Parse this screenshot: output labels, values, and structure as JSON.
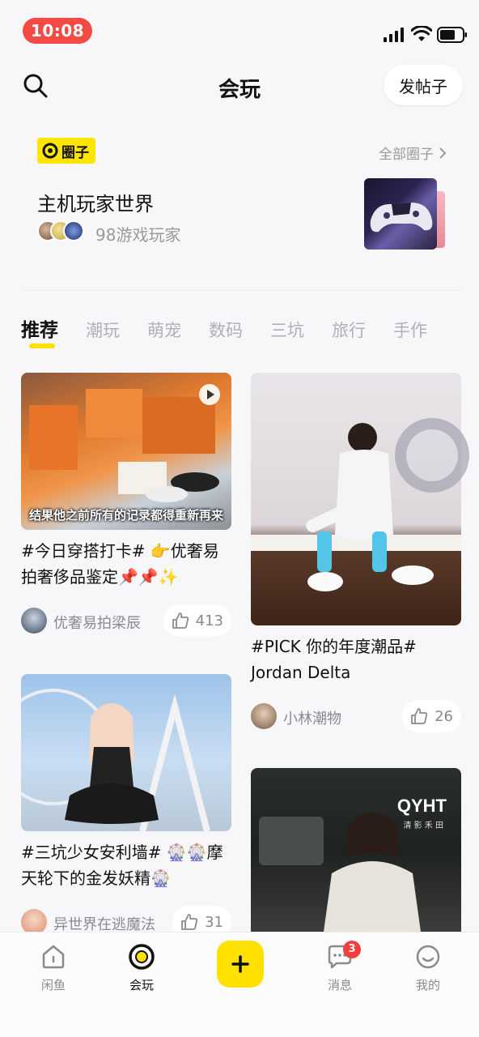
{
  "status_bar": {
    "time": "10:08"
  },
  "header": {
    "title": "会玩",
    "post_button": "发帖子"
  },
  "circle": {
    "badge": "圈子",
    "all_link": "全部圈子",
    "name": "主机玩家世界",
    "member_count": "98游戏玩家"
  },
  "tabs": [
    {
      "label": "推荐",
      "active": true
    },
    {
      "label": "潮玩"
    },
    {
      "label": "萌宠"
    },
    {
      "label": "数码"
    },
    {
      "label": "三坑"
    },
    {
      "label": "旅行"
    },
    {
      "label": "手作"
    }
  ],
  "feed": {
    "card1": {
      "caption": "结果他之前所有的记录都得重新再来",
      "title": "#今日穿搭打卡# 👉优奢易拍奢侈品鉴定📌📌✨",
      "author": "优奢易拍梁辰",
      "likes": "413"
    },
    "card2": {
      "title": "#PICK 你的年度潮品# Jordan Delta",
      "author": "小林潮物",
      "likes": "26"
    },
    "card3": {
      "title": "#三坑少女安利墙# 🎡🎡摩天轮下的金发妖精🎡",
      "author": "异世界在逃魔法",
      "likes": "31"
    },
    "card4": {
      "logo_text": "QYHT",
      "logo_sub": "清 影 禾 田"
    }
  },
  "bottom_nav": {
    "home": "闲鱼",
    "play": "会玩",
    "messages": "消息",
    "messages_badge": "3",
    "mine": "我的"
  },
  "colors": {
    "accent": "#ffe100",
    "time_pill": "#f44a44",
    "badge": "#f43e3e"
  }
}
